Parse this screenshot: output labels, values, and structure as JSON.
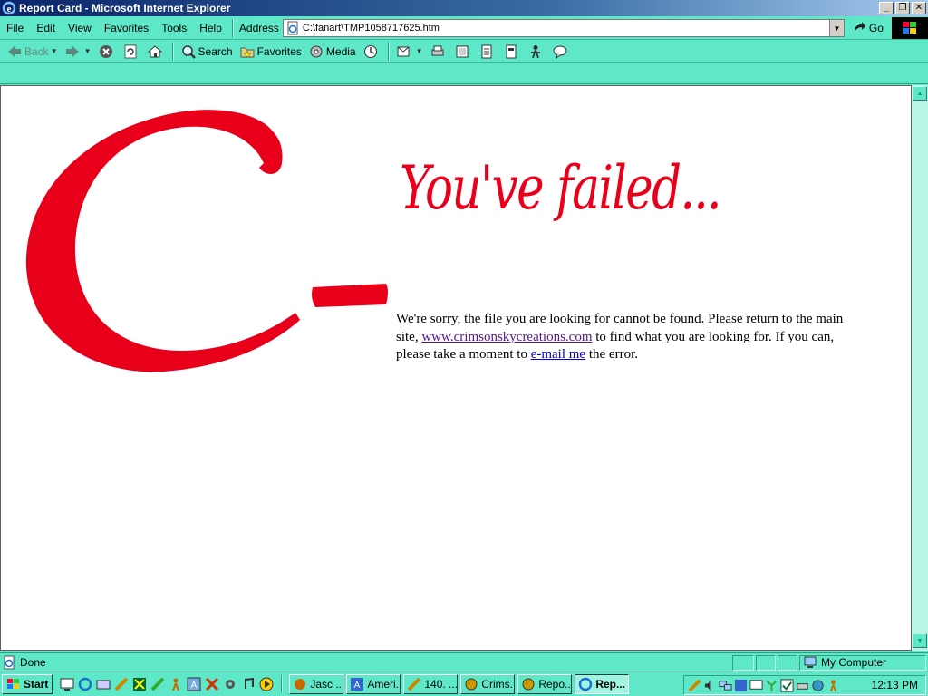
{
  "window": {
    "title": "Report Card - Microsoft Internet Explorer",
    "min_glyph": "_",
    "max_glyph": "❐",
    "close_glyph": "✕"
  },
  "menu": {
    "items": [
      "File",
      "Edit",
      "View",
      "Favorites",
      "Tools",
      "Help"
    ],
    "address_label": "Address",
    "address_value": "C:\\fanart\\TMP1058717625.htm",
    "go_label": "Go"
  },
  "toolbar": {
    "back": "Back",
    "search": "Search",
    "favorites": "Favorites",
    "media": "Media"
  },
  "page": {
    "grade": "C-",
    "headline": "You've failed...",
    "message_part1": "We're sorry, the file you are looking for cannot be found. Please return to the main site, ",
    "site_link": "www.crimsonskycreations.com",
    "message_part2": " to find what you are looking for. If you can, please take a moment to ",
    "email_link": "e-mail me",
    "message_part3": " the error.",
    "accent_color": "#e8001a"
  },
  "status": {
    "text": "Done",
    "zone": "My Computer"
  },
  "taskbar": {
    "start": "Start",
    "tasks": [
      "Jasc ...",
      "Ameri...",
      "140. ...",
      "Crims...",
      "Repo...",
      "Rep..."
    ],
    "active_task_index": 5,
    "clock": "12:13 PM"
  }
}
